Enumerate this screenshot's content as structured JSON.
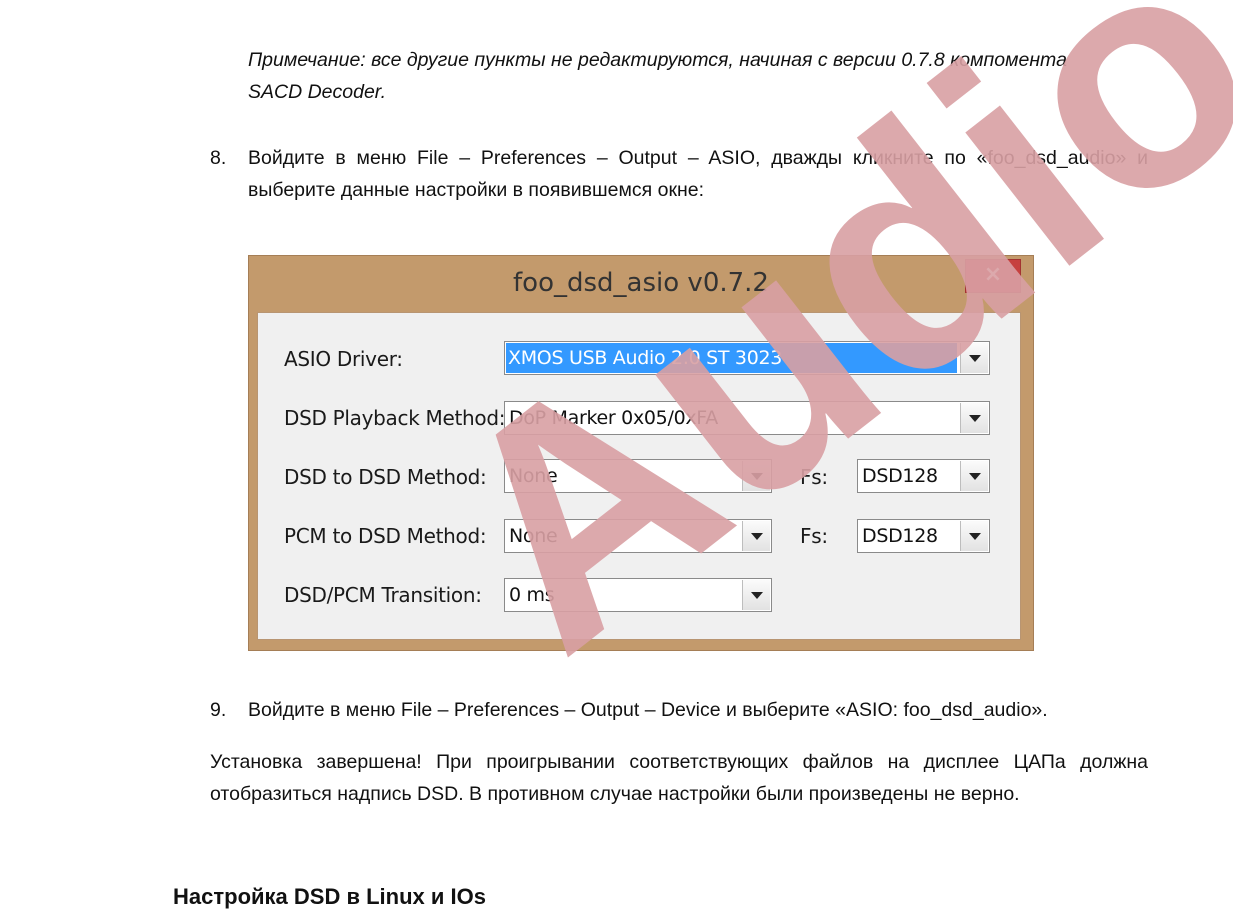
{
  "note": {
    "line1": "Примечание:  все другие пункты не редактируются, начиная с версии 0.7.8 компомента",
    "line2": "SACD Decoder."
  },
  "step8": {
    "number": "8.",
    "text": "Войдите в меню File – Preferences – Output – ASIO, дважды кликните по «foo_dsd_audio» и выберите данные настройки в появившемся окне:"
  },
  "dialog": {
    "title": "foo_dsd_asio v0.7.2",
    "close_label": "×",
    "fields": {
      "asio_driver_label": "ASIO Driver:",
      "asio_driver_value": "XMOS USB Audio 2.0 ST 3023",
      "playback_method_label": "DSD Playback Method:",
      "playback_method_value": "DoP Marker 0x05/0xFA",
      "dsd_to_dsd_label": "DSD to DSD Method:",
      "dsd_to_dsd_value": "None",
      "dsd_fs_label": "Fs:",
      "dsd_fs_value": "DSD128",
      "pcm_to_dsd_label": "PCM to DSD Method:",
      "pcm_to_dsd_value": "None",
      "pcm_fs_label": "Fs:",
      "pcm_fs_value": "DSD128",
      "transition_label": "DSD/PCM Transition:",
      "transition_value": "0 ms"
    }
  },
  "step9": {
    "number": "9.",
    "text": "Войдите в меню File – Preferences – Output – Device и выберите «ASIO: foo_dsd_audio»."
  },
  "final_text": "Установка завершена! При проигрывании соответствующих файлов на дисплее ЦАПа должна отобразиться надпись DSD. В противном случае настройки были произведены не верно.",
  "heading": "Настройка DSD в Linux и IOs",
  "watermark": "Audio",
  "colors": {
    "watermark": "#d9a0a4",
    "window_frame": "#c39a6c",
    "close_button": "#c6413f",
    "selection": "#3399ff"
  }
}
